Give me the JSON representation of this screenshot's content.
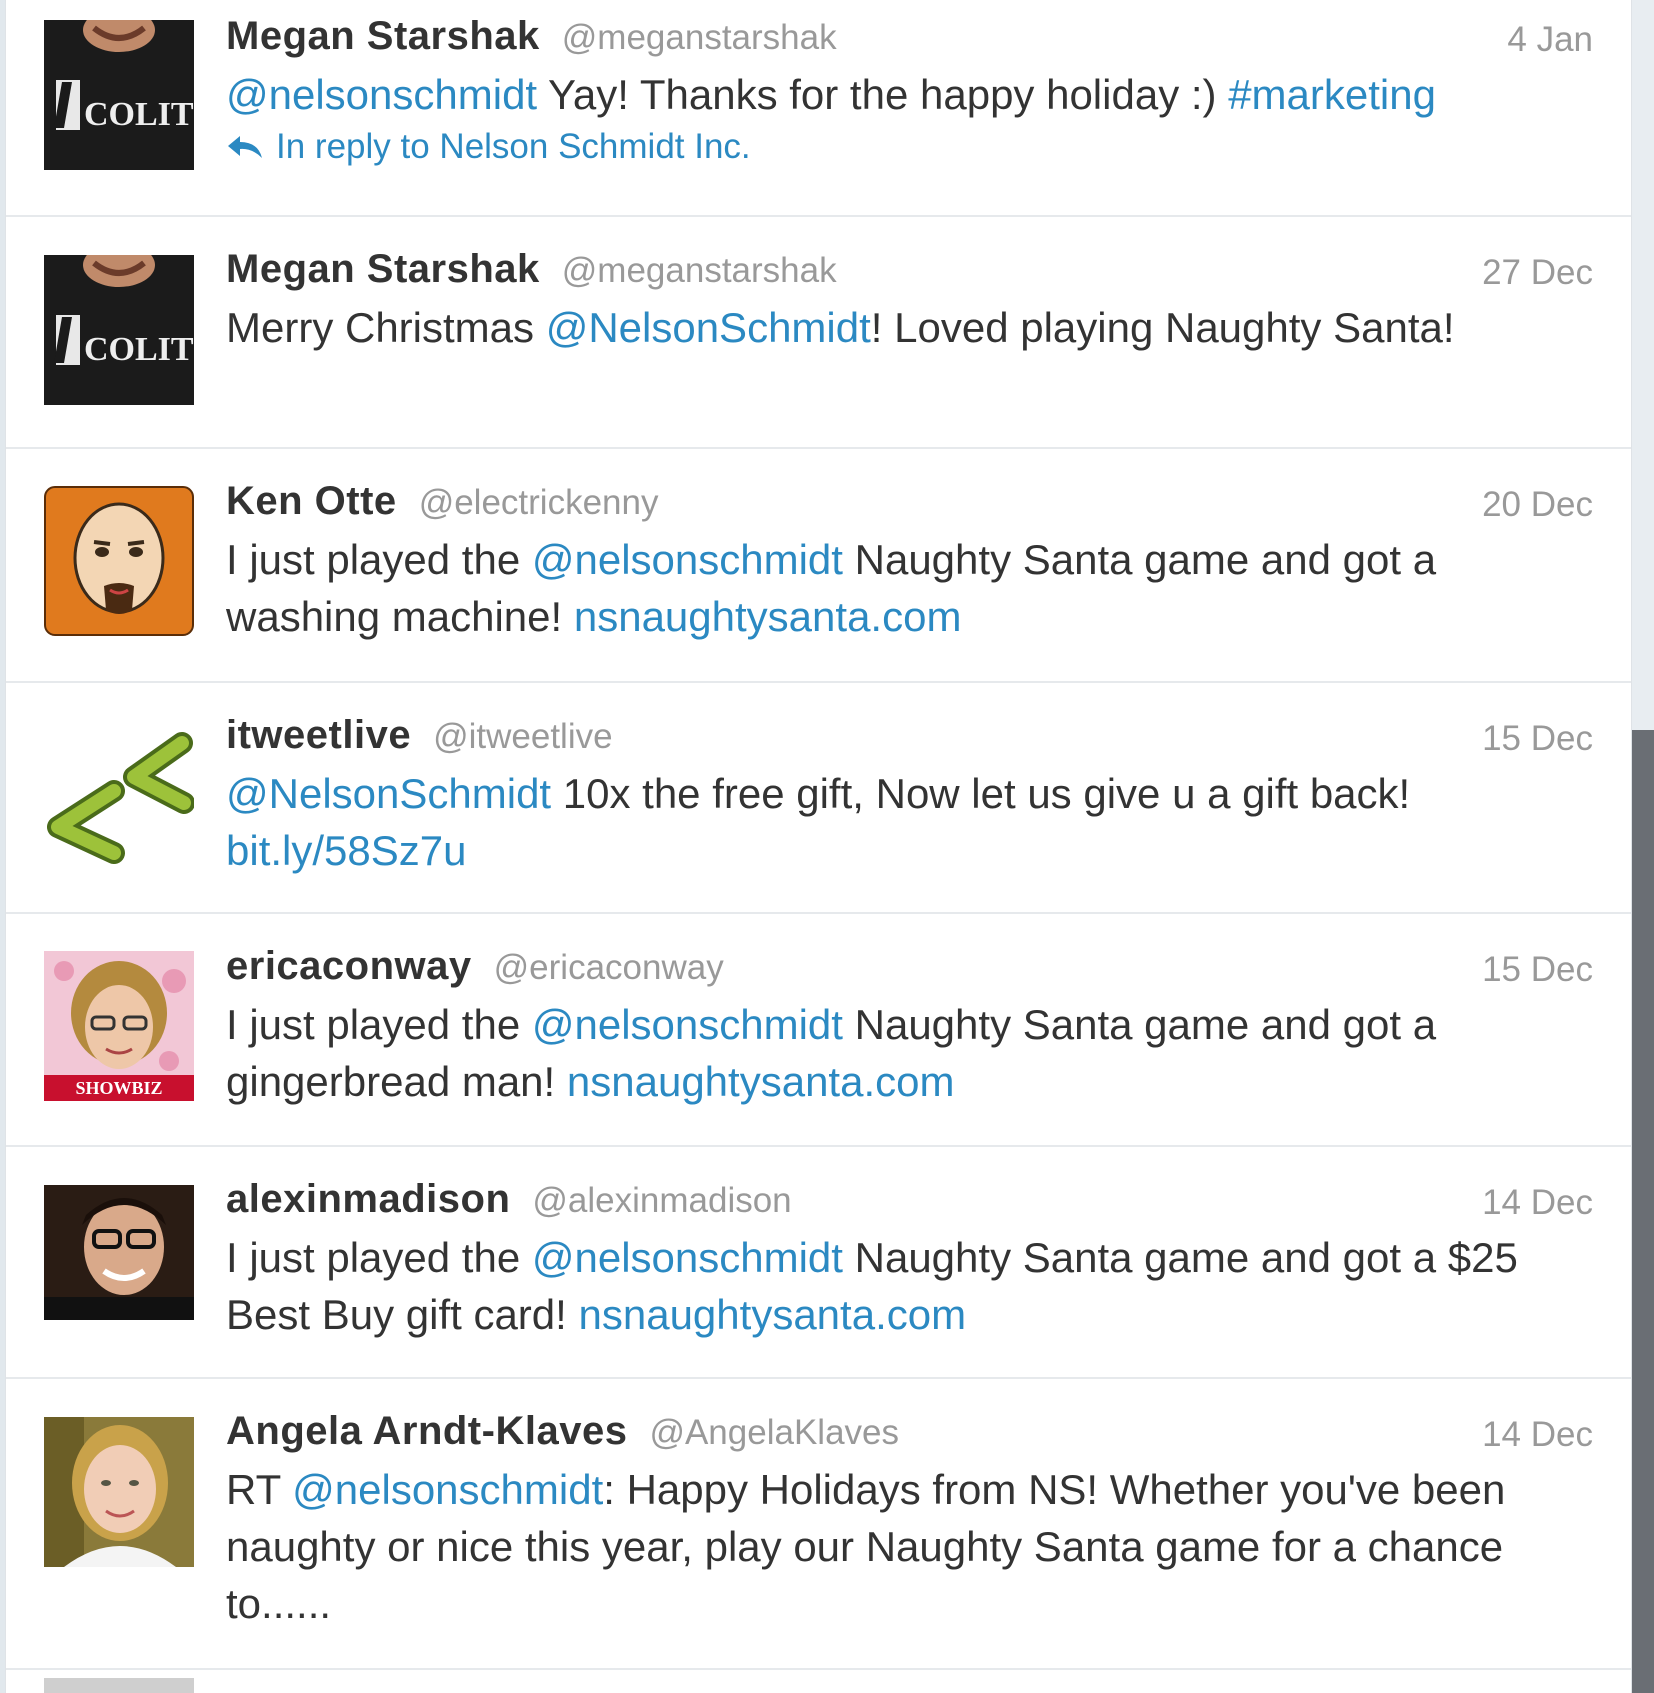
{
  "tweets": [
    {
      "name": "Megan Starshak",
      "handle": "@meganstarshak",
      "time": "4 Jan",
      "avatar_icon": "hooligan-shirt-avatar",
      "segments": [
        {
          "text": "@nelsonschmidt",
          "link": true
        },
        {
          "text": " Yay! Thanks for the happy holiday :) ",
          "link": false
        },
        {
          "text": "#marketing",
          "link": true
        }
      ],
      "reply": "In reply to Nelson Schmidt Inc."
    },
    {
      "name": "Megan Starshak",
      "handle": "@meganstarshak",
      "time": "27 Dec",
      "avatar_icon": "hooligan-shirt-avatar",
      "segments": [
        {
          "text": "Merry Christmas ",
          "link": false
        },
        {
          "text": "@NelsonSchmidt",
          "link": true
        },
        {
          "text": "! Loved playing Naughty Santa!",
          "link": false
        }
      ]
    },
    {
      "name": "Ken Otte",
      "handle": "@electrickenny",
      "time": "20 Dec",
      "avatar_icon": "cartoon-bald-man-avatar",
      "segments": [
        {
          "text": "I just played the ",
          "link": false
        },
        {
          "text": "@nelsonschmidt",
          "link": true
        },
        {
          "text": " Naughty Santa game and got a washing machine! ",
          "link": false
        },
        {
          "text": "nsnaughtysanta.com",
          "link": true
        }
      ]
    },
    {
      "name": "itweetlive",
      "handle": "@itweetlive",
      "time": "15 Dec",
      "avatar_icon": "green-arrows-avatar",
      "segments": [
        {
          "text": "@NelsonSchmidt",
          "link": true
        },
        {
          "text": " 10x the free gift, Now let us give u a gift back! ",
          "link": false
        },
        {
          "text": "bit.ly/58Sz7u",
          "link": true
        }
      ]
    },
    {
      "name": "ericaconway",
      "handle": "@ericaconway",
      "time": "15 Dec",
      "avatar_icon": "woman-glasses-pink-avatar",
      "segments": [
        {
          "text": "I just played the ",
          "link": false
        },
        {
          "text": "@nelsonschmidt",
          "link": true
        },
        {
          "text": " Naughty Santa game and got a gingerbread man! ",
          "link": false
        },
        {
          "text": "nsnaughtysanta.com",
          "link": true
        }
      ]
    },
    {
      "name": "alexinmadison",
      "handle": "@alexinmadison",
      "time": "14 Dec",
      "avatar_icon": "woman-glasses-dark-avatar",
      "segments": [
        {
          "text": "I just played the ",
          "link": false
        },
        {
          "text": "@nelsonschmidt",
          "link": true
        },
        {
          "text": " Naughty Santa game and got a $25 Best Buy gift card! ",
          "link": false
        },
        {
          "text": "nsnaughtysanta.com",
          "link": true
        }
      ]
    },
    {
      "name": "Angela Arndt-Klaves",
      "handle": "@AngelaKlaves",
      "time": "14 Dec",
      "avatar_icon": "blonde-woman-avatar",
      "segments": [
        {
          "text": "RT ",
          "link": false
        },
        {
          "text": "@nelsonschmidt",
          "link": true
        },
        {
          "text": ": Happy Holidays from NS! Whether you've been naughty or nice this year, play our Naughty Santa game for a chance to......",
          "link": false
        }
      ]
    }
  ],
  "colors": {
    "link": "#2b89c2",
    "name": "#333333",
    "meta": "#999999",
    "divider": "#e6e9ec"
  }
}
